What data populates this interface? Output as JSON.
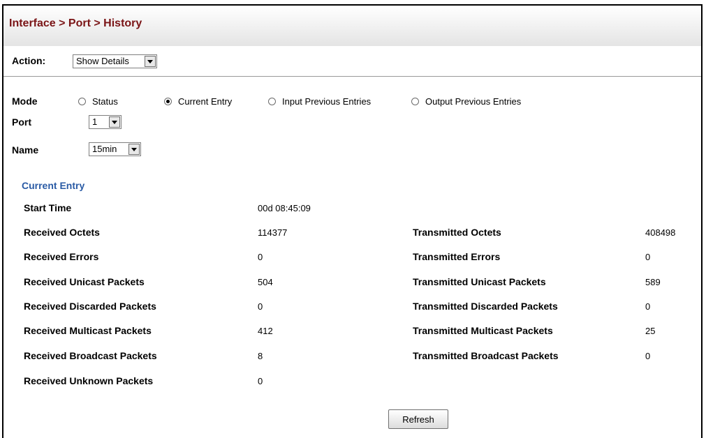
{
  "header": {
    "title": "Interface > Port > History"
  },
  "action": {
    "label": "Action:",
    "selected": "Show Details"
  },
  "form": {
    "mode_label": "Mode",
    "mode_options": [
      {
        "label": "Status",
        "selected": false
      },
      {
        "label": "Current Entry",
        "selected": true
      },
      {
        "label": "Input Previous Entries",
        "selected": false
      },
      {
        "label": "Output Previous Entries",
        "selected": false
      }
    ],
    "port_label": "Port",
    "port_value": "1",
    "name_label": "Name",
    "name_value": "15min"
  },
  "current_entry": {
    "title": "Current Entry",
    "start_time_label": "Start Time",
    "start_time_value": "00d 08:45:09",
    "rows": [
      {
        "left_label": "Received Octets",
        "left_value": "114377",
        "right_label": "Transmitted Octets",
        "right_value": "408498"
      },
      {
        "left_label": "Received Errors",
        "left_value": "0",
        "right_label": "Transmitted Errors",
        "right_value": "0"
      },
      {
        "left_label": "Received Unicast Packets",
        "left_value": "504",
        "right_label": "Transmitted Unicast Packets",
        "right_value": "589"
      },
      {
        "left_label": "Received Discarded Packets",
        "left_value": "0",
        "right_label": "Transmitted Discarded Packets",
        "right_value": "0"
      },
      {
        "left_label": "Received Multicast Packets",
        "left_value": "412",
        "right_label": "Transmitted Multicast Packets",
        "right_value": "25"
      },
      {
        "left_label": "Received Broadcast Packets",
        "left_value": "8",
        "right_label": "Transmitted Broadcast Packets",
        "right_value": "0"
      },
      {
        "left_label": "Received Unknown Packets",
        "left_value": "0",
        "right_label": "",
        "right_value": ""
      }
    ]
  },
  "buttons": {
    "refresh": "Refresh"
  }
}
